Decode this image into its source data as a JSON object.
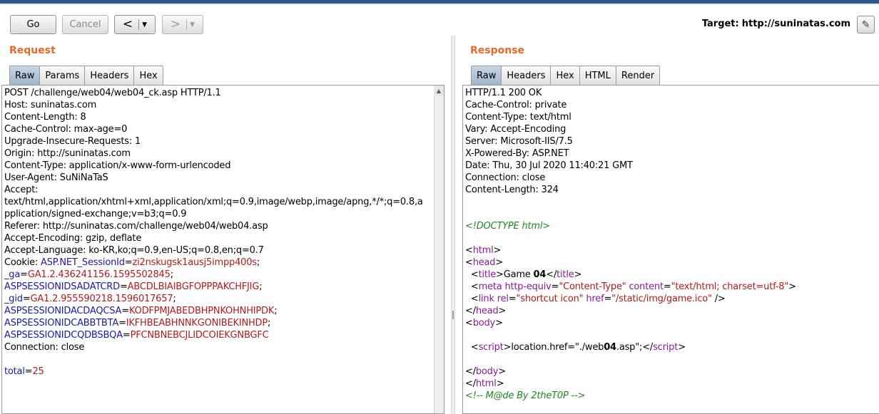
{
  "toolbar": {
    "go_label": "Go",
    "cancel_label": "Cancel",
    "back_arrow": "<",
    "forward_arrow": ">",
    "dropdown": "▼",
    "target_label": "Target:",
    "target_url": "http://suninatas.com",
    "edit_icon": "pencil-icon"
  },
  "request": {
    "title": "Request",
    "tabs": [
      {
        "label": "Raw",
        "active": true
      },
      {
        "label": "Params",
        "active": false
      },
      {
        "label": "Headers",
        "active": false
      },
      {
        "label": "Hex",
        "active": false
      }
    ],
    "lines": [
      "POST /challenge/web04/web04_ck.asp HTTP/1.1",
      "Host: suninatas.com",
      "Content-Length: 8",
      "Cache-Control: max-age=0",
      "Upgrade-Insecure-Requests: 1",
      "Origin: http://suninatas.com",
      "Content-Type: application/x-www-form-urlencoded",
      "User-Agent: SuNiNaTaS",
      "Accept:",
      "text/html,application/xhtml+xml,application/xml;q=0.9,image/webp,image/apng,*/*;q=0.8,a",
      "pplication/signed-exchange;v=b3;q=0.9",
      "Referer: http://suninatas.com/challenge/web04/web04.asp",
      "Accept-Encoding: gzip, deflate",
      "Accept-Language: ko-KR,ko;q=0.9,en-US;q=0.8,en;q=0.7"
    ],
    "cookie_prefix": "Cookie: ",
    "cookies": [
      {
        "name": "ASP.NET_SessionId",
        "value": "zi2nskugsk1ausj5impp400s",
        "sep": ";"
      },
      {
        "name": "_ga",
        "value": "GA1.2.436241156.1595502845",
        "sep": ";"
      },
      {
        "name": "ASPSESSIONIDSADATCRD",
        "value": "ABCDLBIAIBGFOPPPAKCHFJIG",
        "sep": ";"
      },
      {
        "name": "_gid",
        "value": "GA1.2.955590218.1596017657",
        "sep": ";"
      },
      {
        "name": "ASPSESSIONIDACDAQCSA",
        "value": "KODFPMJABEDBHPNKOHNHIPDK",
        "sep": ";"
      },
      {
        "name": "ASPSESSIONIDCABBTBTA",
        "value": "IKFHBEABHNNKGONIBEKINHDP",
        "sep": ";"
      },
      {
        "name": "ASPSESSIONIDCQDBSBQA",
        "value": "PFCNBNEBCJLIDCOIEKGNBGFC",
        "sep": ""
      }
    ],
    "connection": "Connection: close",
    "body_param_name": "total",
    "body_param_value": "25"
  },
  "response": {
    "title": "Response",
    "tabs": [
      {
        "label": "Raw",
        "active": true
      },
      {
        "label": "Headers",
        "active": false
      },
      {
        "label": "Hex",
        "active": false
      },
      {
        "label": "HTML",
        "active": false
      },
      {
        "label": "Render",
        "active": false
      }
    ],
    "headers": [
      "HTTP/1.1 200 OK",
      "Cache-Control: private",
      "Content-Type: text/html",
      "Vary: Accept-Encoding",
      "Server: Microsoft-IIS/7.5",
      "X-Powered-By: ASP.NET",
      "Date: Thu, 30 Jul 2020 11:40:21 GMT",
      "Connection: close",
      "Content-Length: 324"
    ],
    "doctype": "<!DOCTYPE html>",
    "title_text": "Game ",
    "title_num": "04",
    "meta_http_equiv": "\"Content-Type\"",
    "meta_content": "\"text/html; charset=utf-8\"",
    "link_rel": "\"shortcut icon\"",
    "link_href": "\"/static/img/game.ico\"",
    "script_text_a": "location.href=",
    "script_text_b": "\"./web",
    "script_text_c": "04",
    "script_text_d": ".asp\";",
    "comment": "<!-- M@de By 2theT0P -->"
  }
}
